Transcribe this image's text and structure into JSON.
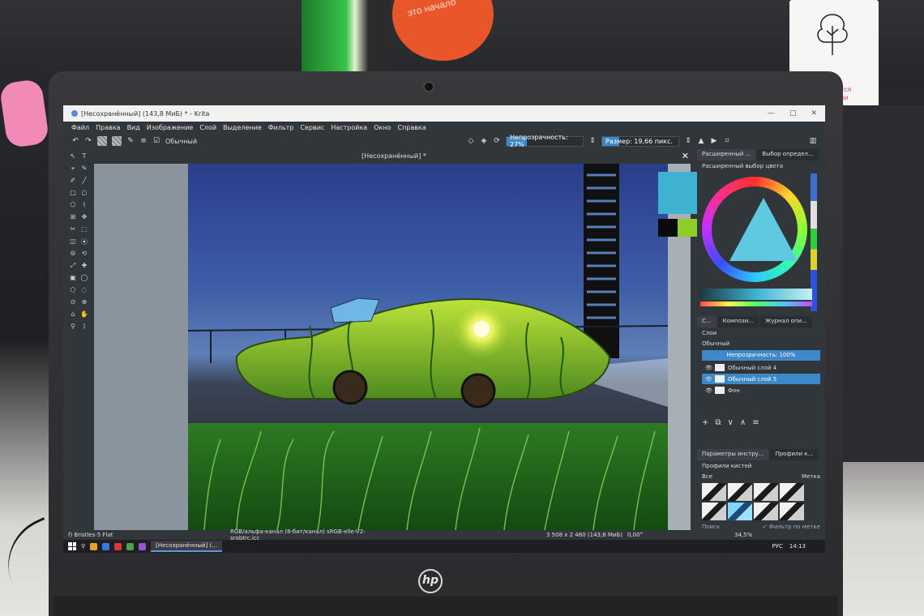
{
  "background": {
    "orange_sign_text": "это начало",
    "card_text": "ется\nики"
  },
  "laptop": {
    "brand": "hp"
  },
  "window": {
    "title": "[Несохранённый] (143,8 МиБ) * - Krita",
    "controls": [
      "—",
      "□",
      "✕"
    ]
  },
  "menu": [
    "Файл",
    "Правка",
    "Вид",
    "Изображение",
    "Слой",
    "Выделение",
    "Фильтр",
    "Сервис",
    "Настройка",
    "Окно",
    "Справка"
  ],
  "toolbar": {
    "blend_mode": "Обычный",
    "opacity_label": "Непрозрачность: 27%",
    "opacity_value": 27,
    "size_label": "Размер: 19,66 пикс.",
    "size_fill_percent": 22,
    "icons": [
      "undo-icon",
      "redo-icon",
      "pattern-icon",
      "gradient-icon",
      "brush-preset-icon",
      "eraser-icon",
      "alpha-icon",
      "reload-icon",
      "mirror-icon",
      "wrap-icon",
      "crop-icon"
    ]
  },
  "tools": [
    "↖",
    "T",
    "⌖",
    "✎",
    "✐",
    "╱",
    "□",
    "○",
    "⬠",
    "⌇",
    "⊞",
    "✥",
    "✂",
    "⬚",
    "◫",
    "⦿",
    "⦾",
    "⟲",
    "⤢",
    "✚",
    "▣",
    "◯",
    "⬡",
    "◌",
    "⊙",
    "⊕",
    "⌂",
    "✋",
    "⚲",
    "⟟"
  ],
  "canvas": {
    "tab_title": "[Несохранённый]  *",
    "close": "✕"
  },
  "colors": {
    "foreground": "#3fb2d2",
    "background_dark": "#0b0b0b",
    "background_green": "#8fcd2a"
  },
  "docker_top": {
    "tabs": [
      "Расширенный ...",
      "Выбор определ..."
    ],
    "title": "Расширенный выбор цвета"
  },
  "docker_layers": {
    "tabs": [
      "С...",
      "Компози...",
      "Журнал опи..."
    ],
    "title": "Слои",
    "blend_mode": "Обычный",
    "opacity": "Непрозрачность:  100%",
    "layers": [
      {
        "name": "Обычный слой 4",
        "selected": false
      },
      {
        "name": "Обычный слой 5",
        "selected": true
      },
      {
        "name": "Фон",
        "selected": false
      }
    ],
    "buttons": [
      "+",
      "⧉",
      "∨",
      "∧",
      "≡"
    ]
  },
  "docker_presets": {
    "tabs": [
      "Параметры инстру...",
      "Профили к..."
    ],
    "title": "Профили кистей",
    "filter_all": "Все",
    "tag_label": "Метка",
    "search_placeholder": "Поиск",
    "filter_by_tag": "✓ Фильтр по метке"
  },
  "statusbar": {
    "brush": "f) Bristles-5 Flat",
    "colorspace": "RGB/альфа-канал (8-бит/канал)  sRGB-elle-V2-srgbtrc.icc",
    "image_size": "3 508 x 2 480 (143,8 МиБ)",
    "rotation": "0,00°",
    "zoom": "34,5%"
  },
  "taskbar": {
    "active_app": "[Несохранённый] (...",
    "language": "РУС",
    "time": "14:13"
  }
}
